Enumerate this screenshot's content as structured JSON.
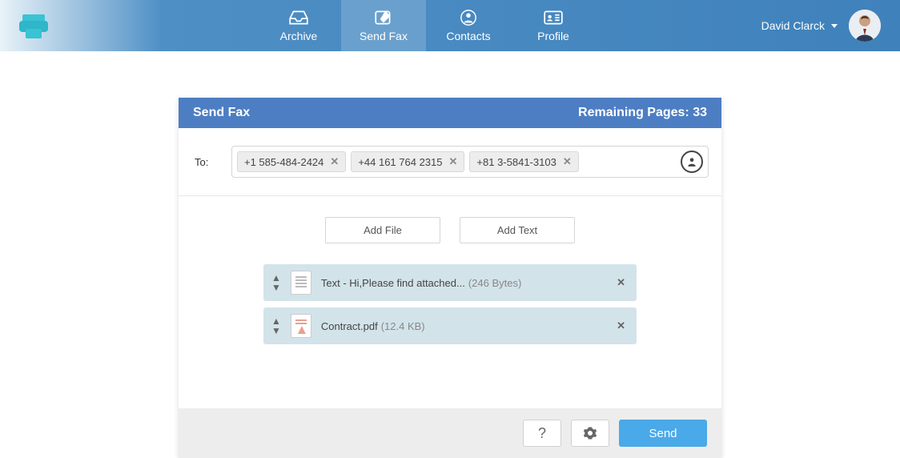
{
  "header": {
    "nav": [
      {
        "id": "archive",
        "label": "Archive"
      },
      {
        "id": "sendfax",
        "label": "Send Fax"
      },
      {
        "id": "contacts",
        "label": "Contacts"
      },
      {
        "id": "profile",
        "label": "Profile"
      }
    ],
    "user_name": "David Clarck"
  },
  "panel": {
    "title": "Send Fax",
    "remaining_label": "Remaining Pages: ",
    "remaining_value": "33",
    "to_label": "To:",
    "recipients": [
      "+1 585-484-2424",
      "+44 161 764 2315",
      "+81 3-5841-3103"
    ],
    "add_file_label": "Add File",
    "add_text_label": "Add Text",
    "attachments": [
      {
        "type": "text",
        "label": "Text - Hi,Please find attached...",
        "size": "(246 Bytes)"
      },
      {
        "type": "pdf",
        "label": "Contract.pdf",
        "size": "(12.4 KB)"
      }
    ],
    "help_label": "?",
    "send_label": "Send"
  }
}
